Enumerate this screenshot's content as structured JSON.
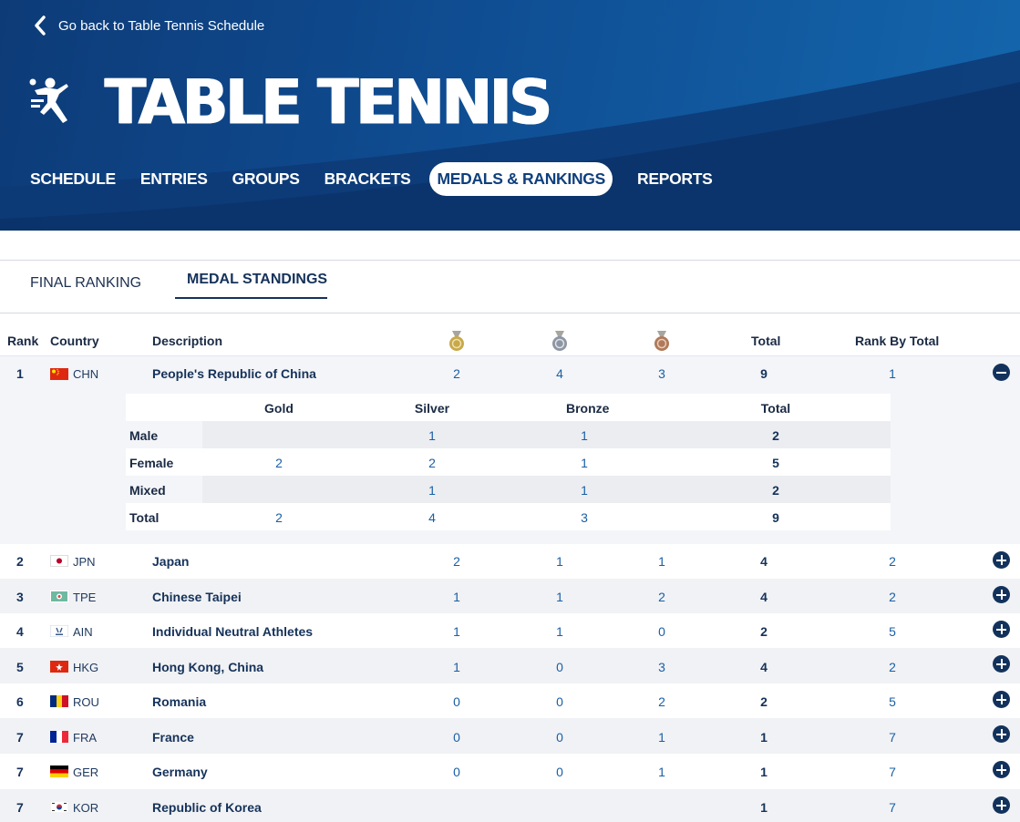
{
  "header": {
    "back_label": "Go back to Table Tennis Schedule",
    "sport_title": "TABLE TENNIS",
    "nav": [
      {
        "label": "SCHEDULE"
      },
      {
        "label": "ENTRIES"
      },
      {
        "label": "GROUPS"
      },
      {
        "label": "BRACKETS"
      },
      {
        "label": "MEDALS & RANKINGS",
        "active": true
      },
      {
        "label": "REPORTS"
      }
    ]
  },
  "tabs": {
    "final_ranking": "FINAL RANKING",
    "medal_standings": "MEDAL STANDINGS",
    "active": "medal_standings"
  },
  "table": {
    "headers": {
      "rank": "Rank",
      "country": "Country",
      "description": "Description",
      "gold_icon": "gold-medal-icon",
      "silver_icon": "silver-medal-icon",
      "bronze_icon": "bronze-medal-icon",
      "total": "Total",
      "rank_by_total": "Rank By Total"
    },
    "rows": [
      {
        "rank": "1",
        "code": "CHN",
        "flag": "china-flag-icon",
        "description": "People's Republic of China",
        "gold": "2",
        "silver": "4",
        "bronze": "3",
        "total": "9",
        "rank_by_total": "1",
        "expanded": true
      },
      {
        "rank": "2",
        "code": "JPN",
        "flag": "japan-flag-icon",
        "description": "Japan",
        "gold": "2",
        "silver": "1",
        "bronze": "1",
        "total": "4",
        "rank_by_total": "2"
      },
      {
        "rank": "3",
        "code": "TPE",
        "flag": "chinese-taipei-flag-icon",
        "description": "Chinese Taipei",
        "gold": "1",
        "silver": "1",
        "bronze": "2",
        "total": "4",
        "rank_by_total": "2"
      },
      {
        "rank": "4",
        "code": "AIN",
        "flag": "ain-flag-icon",
        "description": "Individual Neutral Athletes",
        "gold": "1",
        "silver": "1",
        "bronze": "0",
        "total": "2",
        "rank_by_total": "5"
      },
      {
        "rank": "5",
        "code": "HKG",
        "flag": "hong-kong-flag-icon",
        "description": "Hong Kong, China",
        "gold": "1",
        "silver": "0",
        "bronze": "3",
        "total": "4",
        "rank_by_total": "2"
      },
      {
        "rank": "6",
        "code": "ROU",
        "flag": "romania-flag-icon",
        "description": "Romania",
        "gold": "0",
        "silver": "0",
        "bronze": "2",
        "total": "2",
        "rank_by_total": "5"
      },
      {
        "rank": "7",
        "code": "FRA",
        "flag": "france-flag-icon",
        "description": "France",
        "gold": "0",
        "silver": "0",
        "bronze": "1",
        "total": "1",
        "rank_by_total": "7"
      },
      {
        "rank": "7",
        "code": "GER",
        "flag": "germany-flag-icon",
        "description": "Germany",
        "gold": "0",
        "silver": "0",
        "bronze": "1",
        "total": "1",
        "rank_by_total": "7"
      },
      {
        "rank": "7",
        "code": "KOR",
        "flag": "korea-flag-icon",
        "description": "Republic of Korea",
        "gold": "",
        "silver": "",
        "bronze": "",
        "total": "1",
        "rank_by_total": "7"
      }
    ],
    "breakdown": {
      "headers": [
        "Gold",
        "Silver",
        "Bronze",
        "Total"
      ],
      "rows": [
        {
          "label": "Male",
          "gold": "",
          "silver": "1",
          "bronze": "1",
          "total": "2"
        },
        {
          "label": "Female",
          "gold": "2",
          "silver": "2",
          "bronze": "1",
          "total": "5"
        },
        {
          "label": "Mixed",
          "gold": "",
          "silver": "1",
          "bronze": "1",
          "total": "2"
        },
        {
          "label": "Total",
          "gold": "2",
          "silver": "4",
          "bronze": "3",
          "total": "9"
        }
      ]
    }
  },
  "colors": {
    "header_blue": "#0f4d92",
    "navy_text": "#15325a",
    "link_blue": "#1a5fa5",
    "gold": "#c9a84a",
    "silver": "#8e96a3",
    "bronze": "#b07a5a"
  }
}
